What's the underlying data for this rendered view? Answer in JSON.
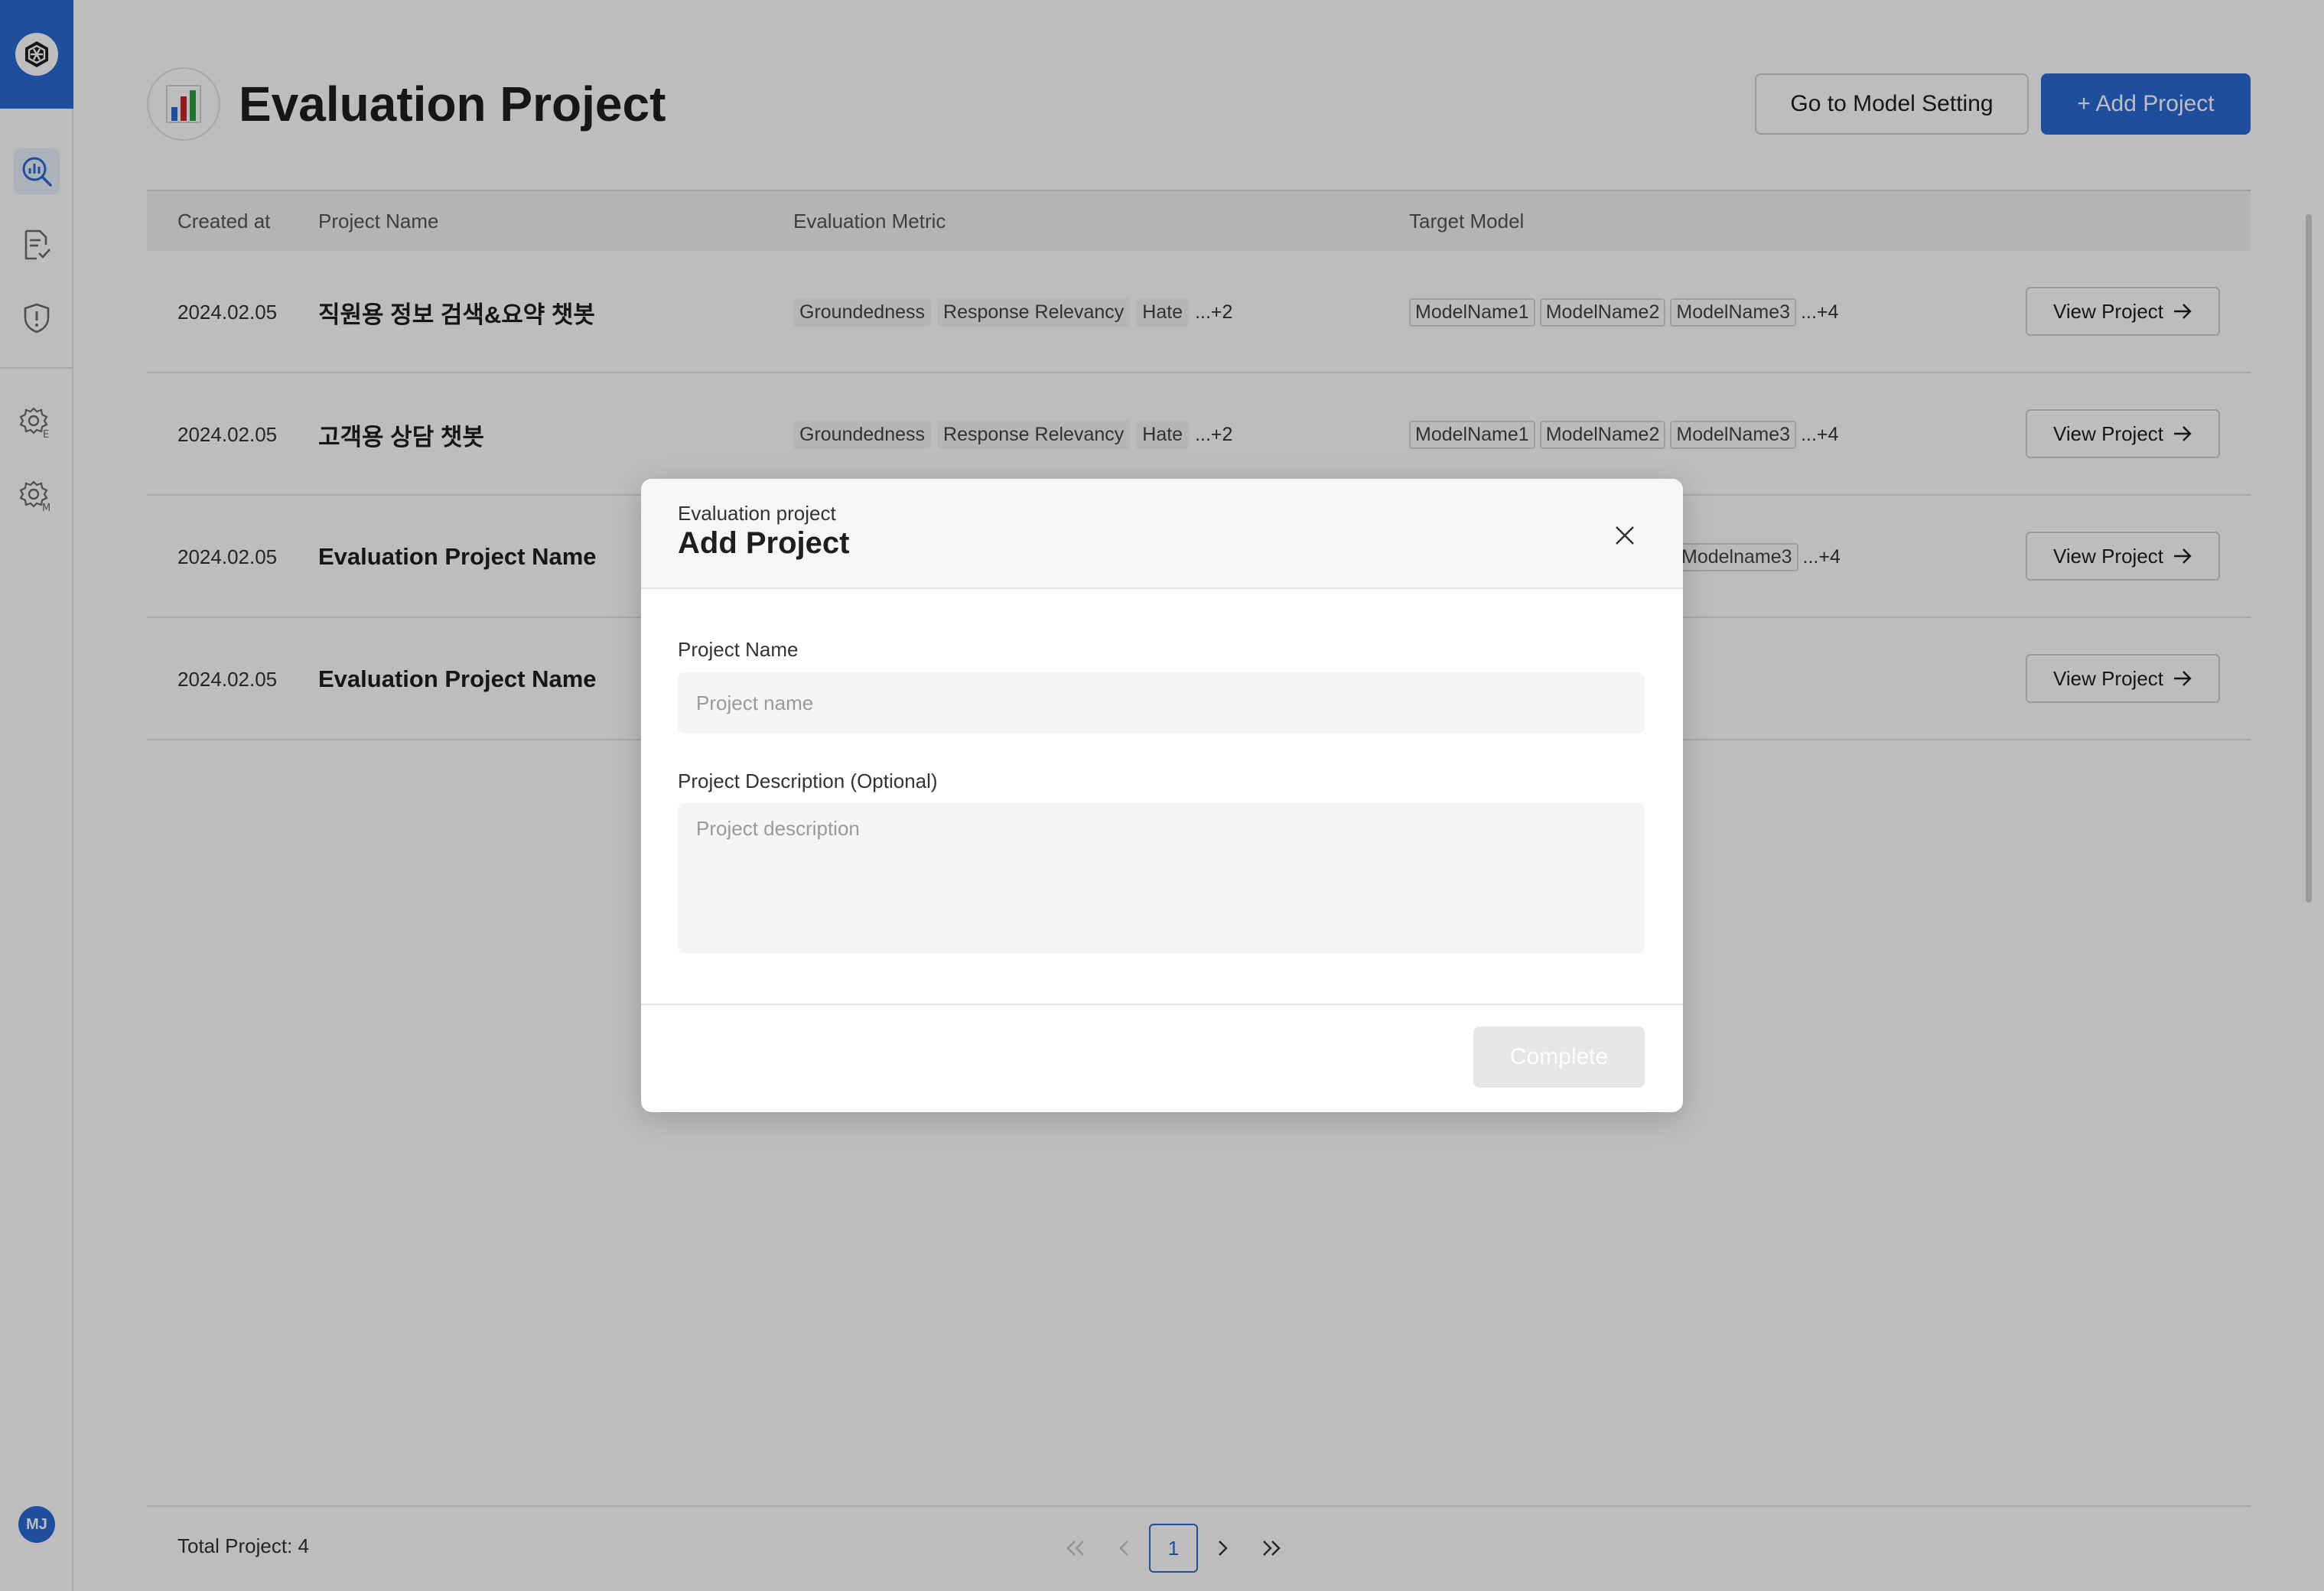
{
  "sidebar": {
    "items": [
      {
        "icon": "evaluation-icon",
        "active": true
      },
      {
        "icon": "document-check-icon",
        "active": false
      },
      {
        "icon": "shield-alert-icon",
        "active": false
      },
      {
        "icon": "settings-e-icon",
        "active": false
      },
      {
        "icon": "settings-m-icon",
        "active": false
      }
    ],
    "avatar": "MJ"
  },
  "header": {
    "title": "Evaluation Project",
    "model_setting_label": "Go to Model Setting",
    "add_project_label": "+ Add Project"
  },
  "table": {
    "columns": [
      "Created at",
      "Project Name",
      "Evaluation Metric",
      "Target Model"
    ],
    "view_label": "View Project",
    "rows": [
      {
        "created_at": "2024.02.05",
        "name": "직원용 정보 검색&요약 챗봇",
        "metrics": [
          "Groundedness",
          "Response Relevancy",
          "Hate"
        ],
        "metrics_more": "...+2",
        "models": [
          "ModelName1",
          "ModelName2",
          "ModelName3"
        ],
        "models_more": "...+4"
      },
      {
        "created_at": "2024.02.05",
        "name": "고객용 상담 챗봇",
        "metrics": [
          "Groundedness",
          "Response Relevancy",
          "Hate"
        ],
        "metrics_more": "...+2",
        "models": [
          "ModelName1",
          "ModelName2",
          "ModelName3"
        ],
        "models_more": "...+4"
      },
      {
        "created_at": "2024.02.05",
        "name": "Evaluation Project Name",
        "visible_model": "Modelname3",
        "models_more": "...+4"
      },
      {
        "created_at": "2024.02.05",
        "name": "Evaluation Project Name"
      }
    ]
  },
  "footer": {
    "total": "Total Project: 4",
    "current_page": "1"
  },
  "modal": {
    "subtitle": "Evaluation project",
    "title": "Add Project",
    "name_label": "Project Name",
    "name_placeholder": "Project name",
    "name_value": "",
    "desc_label": "Project Description (Optional)",
    "desc_placeholder": "Project description",
    "desc_value": "",
    "complete_label": "Complete"
  },
  "colors": {
    "primary": "#2c6ad6",
    "overlay": "rgba(0,0,0,0.26)",
    "disabled": "#e6e6e6"
  }
}
